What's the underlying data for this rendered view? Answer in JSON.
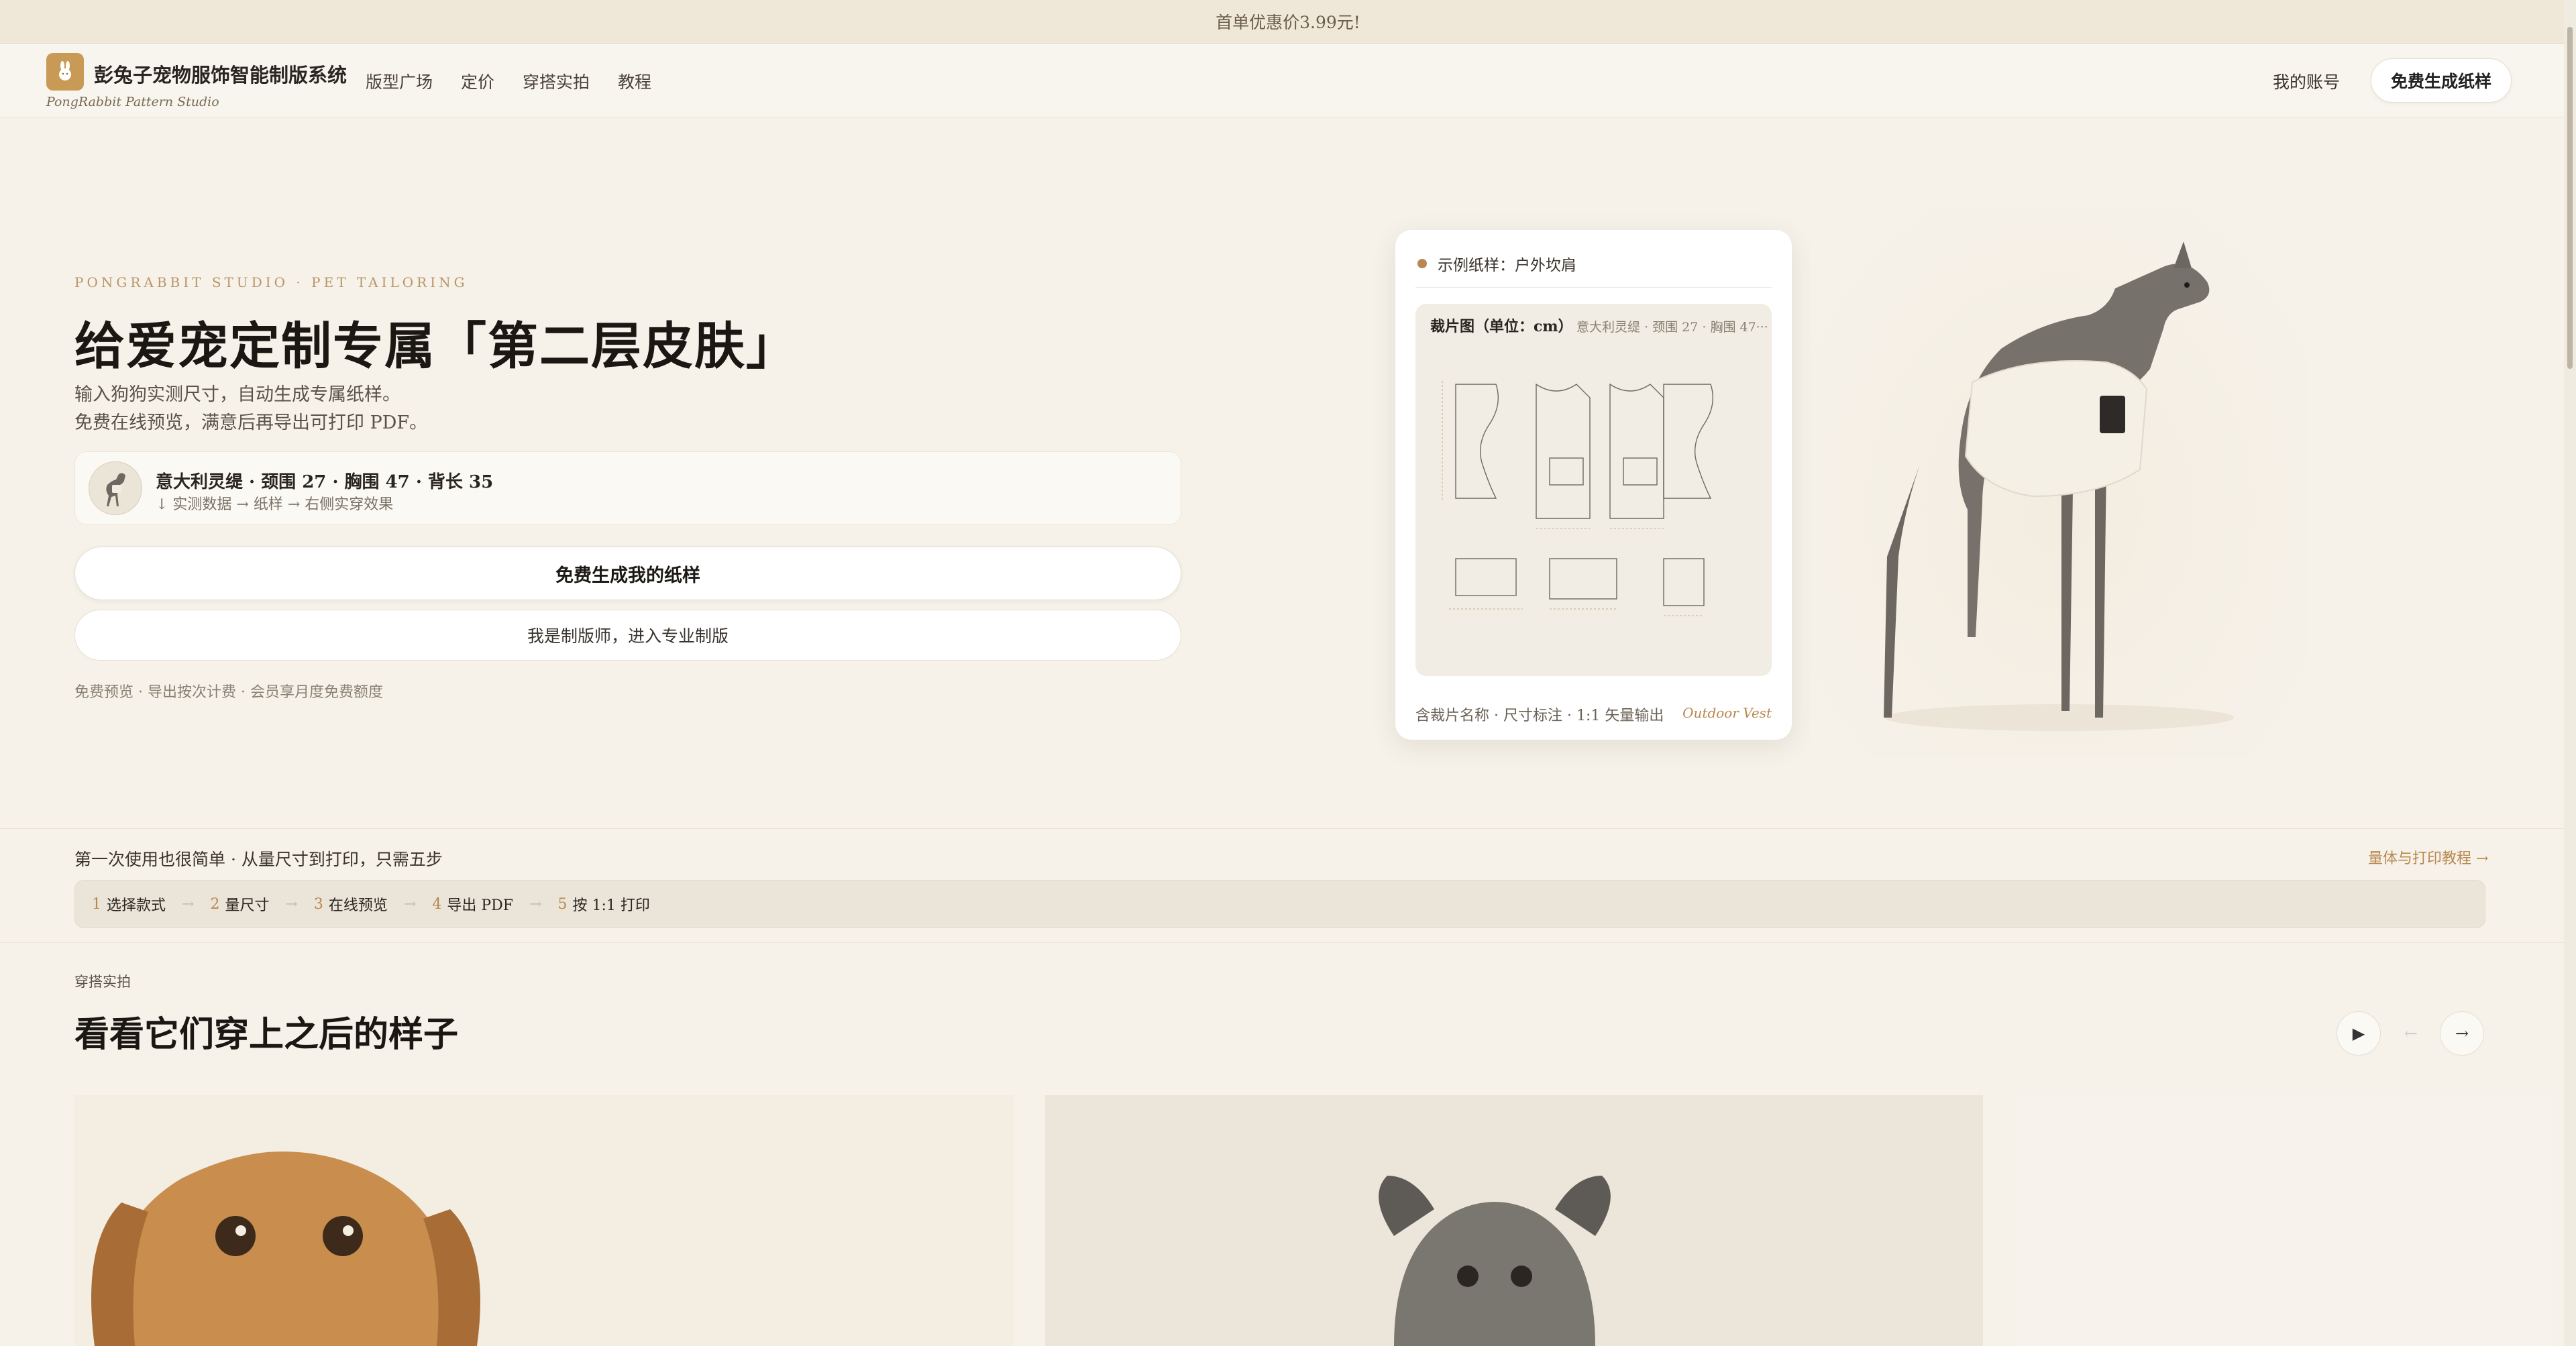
{
  "promo": {
    "text": "首单优惠价3.99元!"
  },
  "header": {
    "brand": "彭兔子宠物服饰智能制版系统",
    "brand_sub": "PongRabbit Pattern Studio",
    "nav": [
      "版型广场",
      "定价",
      "穿搭实拍",
      "教程"
    ],
    "account": "我的账号",
    "cta": "免费生成纸样"
  },
  "hero": {
    "eyebrow": "PONGRABBIT STUDIO · PET TAILORING",
    "title": "给爱宠定制专属「第二层皮肤」",
    "desc_line1": "输入狗狗实测尺寸，自动生成专属纸样。",
    "desc_line2": "免费在线预览，满意后再导出可打印 PDF。",
    "sample_main": "意大利灵缇 · 颈围 27 · 胸围 47 · 背长 35",
    "sample_sub": "↓ 实测数据 → 纸样 → 右侧实穿效果",
    "btn_primary": "免费生成我的纸样",
    "btn_secondary": "我是制版师，进入专业制版",
    "fineprint": "免费预览 · 导出按次计费 · 会员享月度免费额度"
  },
  "pattern_card": {
    "title": "示例纸样：户外坎肩",
    "sheet_head": "裁片图（单位：cm）",
    "sheet_meta": "意大利灵缇 · 颈围 27 · 胸围 47···",
    "footer": "含裁片名称 · 尺寸标注 · 1:1 矢量输出",
    "footer_brand": "Outdoor Vest"
  },
  "steps": {
    "intro": "第一次使用也很简单 · 从量尺寸到打印，只需五步",
    "link": "量体与打印教程 →",
    "items": [
      {
        "num": "1",
        "label": "选择款式"
      },
      {
        "num": "2",
        "label": "量尺寸"
      },
      {
        "num": "3",
        "label": "在线预览"
      },
      {
        "num": "4",
        "label": "导出 PDF"
      },
      {
        "num": "5",
        "label": "按 1:1 打印"
      }
    ],
    "arrow": "→"
  },
  "gallery": {
    "eyebrow": "穿搭实拍",
    "title": "看看它们穿上之后的样子",
    "play": "▶",
    "prev": "←",
    "next": "→"
  },
  "colors": {
    "accent": "#b8884e",
    "background": "#f6f2ea",
    "logo": "#c89a56"
  }
}
